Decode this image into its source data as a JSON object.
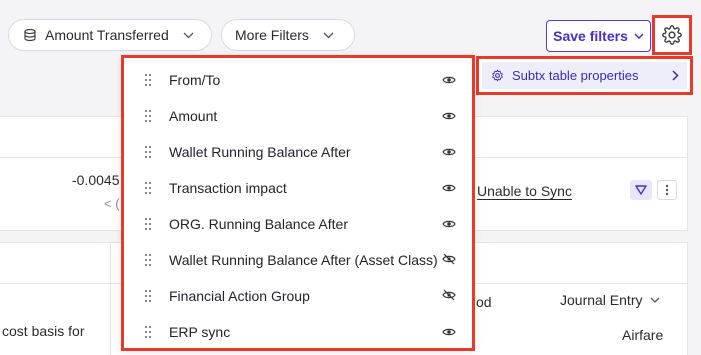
{
  "filters": {
    "amount_transferred_label": "Amount Transferred",
    "more_filters_label": "More Filters",
    "save_filters_label": "Save filters"
  },
  "settings_menu": {
    "subtx_label": "Subtx table properties"
  },
  "table_properties": {
    "items": [
      {
        "label": "From/To",
        "visibility": "visible",
        "icon": "eye-icon"
      },
      {
        "label": "Amount",
        "visibility": "visible",
        "icon": "eye-icon"
      },
      {
        "label": "Wallet Running Balance After",
        "visibility": "visible",
        "icon": "eye-icon"
      },
      {
        "label": "Transaction impact",
        "visibility": "visible",
        "icon": "eye-icon"
      },
      {
        "label": "ORG. Running Balance After",
        "visibility": "visible",
        "icon": "eye-icon"
      },
      {
        "label": "Wallet Running Balance After (Asset Class)",
        "visibility": "hidden",
        "icon": "eye-off-icon"
      },
      {
        "label": "Financial Action Group",
        "visibility": "hidden",
        "icon": "eye-off-icon"
      },
      {
        "label": "ERP sync",
        "visibility": "visible",
        "icon": "eye-icon"
      }
    ]
  },
  "background": {
    "amount_value": "-0.0045",
    "amount_sub": "< (",
    "sync_status": "Unable to Sync",
    "column_fragment": "od",
    "journal_entry_label": "Journal Entry",
    "airfare_value": "Airfare",
    "cost_basis_fragment": "cost basis for"
  },
  "colors": {
    "accent": "#4b2ec9",
    "highlight_border": "#e8392b",
    "submenu_bg": "#eeeefb"
  }
}
